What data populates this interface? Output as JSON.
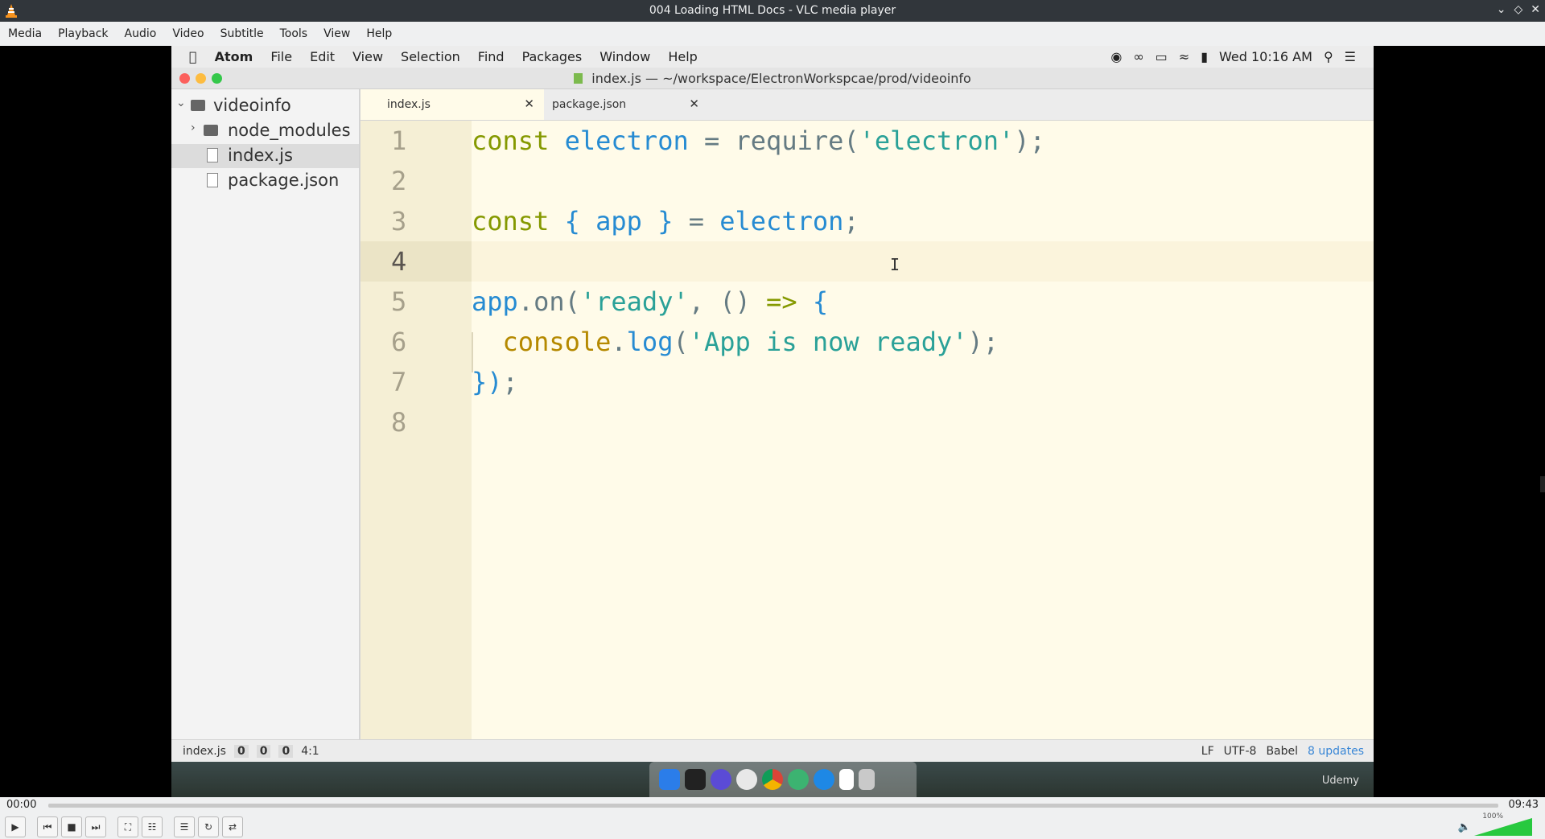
{
  "vlc": {
    "title": "004 Loading HTML Docs - VLC media player",
    "menu": [
      "Media",
      "Playback",
      "Audio",
      "Video",
      "Subtitle",
      "Tools",
      "View",
      "Help"
    ],
    "time_current": "00:00",
    "time_total": "09:43",
    "progress": 0.0,
    "volume_label": "100%",
    "volume": 1.0
  },
  "mac": {
    "menu": [
      "Atom",
      "File",
      "Edit",
      "View",
      "Selection",
      "Find",
      "Packages",
      "Window",
      "Help"
    ],
    "clock": "Wed 10:16 AM"
  },
  "atom": {
    "window_title": "index.js — ~/workspace/ElectronWorkspcae/prod/videoinfo",
    "tree": {
      "root": "videoinfo",
      "items": [
        "node_modules",
        "index.js",
        "package.json"
      ]
    },
    "tabs": [
      "index.js",
      "package.json"
    ],
    "line_numbers": [
      "1",
      "2",
      "3",
      "4",
      "5",
      "6",
      "7",
      "8"
    ],
    "status": {
      "file": "index.js",
      "counts": [
        "0",
        "0",
        "0"
      ],
      "cursor": "4:1",
      "line_ending": "LF",
      "encoding": "UTF-8",
      "grammar": "Babel",
      "updates": "8 updates"
    }
  },
  "code": {
    "l1": [
      "const",
      " electron",
      " =",
      " require(",
      "'electron'",
      ");"
    ],
    "l3": [
      "const",
      " {",
      " app",
      " }",
      " =",
      " electron",
      ";"
    ],
    "l5": [
      "app",
      ".on(",
      "'ready'",
      ",",
      " ()",
      " =>",
      " {"
    ],
    "l6": [
      "  console",
      ".",
      "log",
      "(",
      "'App is now ready'",
      ");"
    ],
    "l7": [
      "})",
      ";"
    ]
  },
  "udemy": "Udemy",
  "colors": {
    "keyword": "#859900",
    "identifier": "#268bd2",
    "string": "#2aa198",
    "editor_bg": "#fffbe9"
  }
}
